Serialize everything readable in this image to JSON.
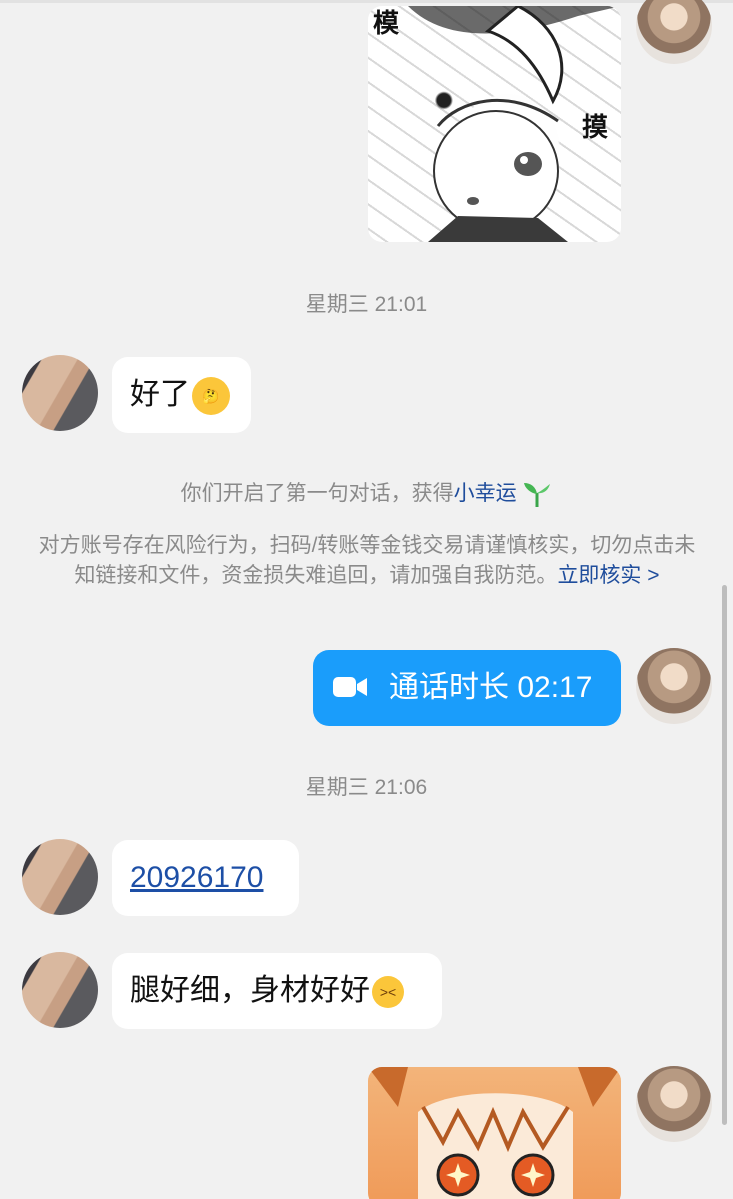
{
  "timestamps": {
    "first": "星期三 21:01",
    "second": "星期三 21:06"
  },
  "messages": {
    "hao_le": "好了",
    "call_duration": "通话时长 02:17",
    "number_link": "20926170",
    "compliment": "腿好细，身材好好"
  },
  "system": {
    "first_chat_prefix": "你们开启了第一句对话，获得",
    "first_chat_link": "小幸运",
    "warning_text": "对方账号存在风险行为，扫码/转账等金钱交易请谨慎核实，切勿点击未知链接和文件，资金损失难追回，请加强自我防范。",
    "warning_link": "立即核实 >"
  },
  "colors": {
    "background": "#f1f1f1",
    "bubble_peer": "#ffffff",
    "bubble_self_call": "#1a9dfb",
    "link": "#1f4d9c",
    "system_text": "#8a8a8a"
  },
  "icons": {
    "call": "video-camera-icon",
    "emoji_1": "thinking-face-emoji",
    "emoji_2": "laughing-squint-emoji",
    "sprout": "sprout-icon"
  }
}
